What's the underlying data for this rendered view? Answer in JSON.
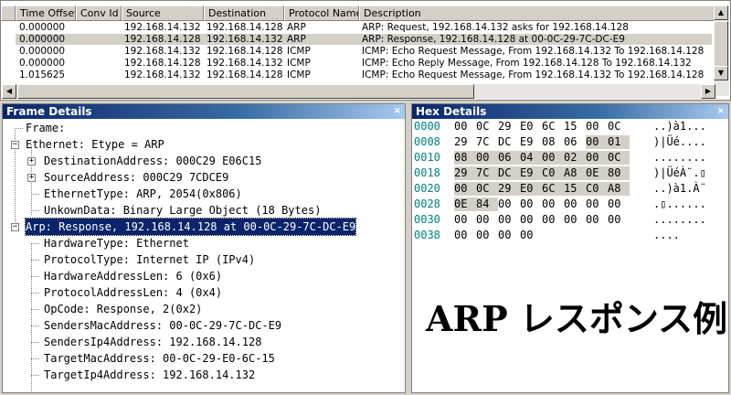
{
  "list": {
    "columns": [
      "Time Offset",
      "Conv Id",
      "Source",
      "Destination",
      "Protocol Name",
      "Description"
    ],
    "rows": [
      {
        "time": "0.000000",
        "conv": "",
        "src": "192.168.14.132",
        "dst": "192.168.14.128",
        "proto": "ARP",
        "desc": "ARP: Request, 192.168.14.132 asks for 192.168.14.128"
      },
      {
        "time": "0.000000",
        "conv": "",
        "src": "192.168.14.128",
        "dst": "192.168.14.132",
        "proto": "ARP",
        "desc": "ARP: Response, 192.168.14.128 at 00-0C-29-7C-DC-E9"
      },
      {
        "time": "0.000000",
        "conv": "",
        "src": "192.168.14.132",
        "dst": "192.168.14.128",
        "proto": "ICMP",
        "desc": "ICMP: Echo Request Message, From 192.168.14.132 To 192.168.14.128"
      },
      {
        "time": "0.000000",
        "conv": "",
        "src": "192.168.14.128",
        "dst": "192.168.14.132",
        "proto": "ICMP",
        "desc": "ICMP: Echo Reply Message, From 192.168.14.128 To 192.168.14.132"
      },
      {
        "time": "1.015625",
        "conv": "",
        "src": "192.168.14.132",
        "dst": "192.168.14.128",
        "proto": "ICMP",
        "desc": "ICMP: Echo Request Message, From 192.168.14.132 To 192.168.14.128"
      }
    ]
  },
  "frame": {
    "title": "Frame Details",
    "close": "×",
    "items": {
      "frame": "Frame:",
      "ethernet": "Ethernet: Etype = ARP",
      "dest": "DestinationAddress: 000C29 E06C15",
      "src": "SourceAddress: 000C29 7CDCE9",
      "etype": "EthernetType: ARP, 2054(0x806)",
      "unk": "UnkownData: Binary Large Object (18 Bytes)",
      "arp": "Arp: Response, 192.168.14.128 at 00-0C-29-7C-DC-E9",
      "hw": "HardwareType: Ethernet",
      "pt": "ProtocolType: Internet IP (IPv4)",
      "hal": "HardwareAddressLen: 6 (0x6)",
      "pal": "ProtocolAddressLen: 4 (0x4)",
      "op": "OpCode: Response, 2(0x2)",
      "smac": "SendersMacAddress: 00-0C-29-7C-DC-E9",
      "sip": "SendersIp4Address: 192.168.14.128",
      "tmac": "TargetMacAddress: 00-0C-29-E0-6C-15",
      "tip": "TargetIp4Address: 192.168.14.132"
    }
  },
  "hex": {
    "title": "Hex Details",
    "close": "×",
    "rows": [
      {
        "off": "0000",
        "bytes": [
          "00",
          "0C",
          "29",
          "E0",
          "6C",
          "15",
          "00",
          "0C"
        ],
        "ascii": "..)à1..."
      },
      {
        "off": "0008",
        "bytes": [
          "29",
          "7C",
          "DC",
          "E9",
          "08",
          "06",
          "00",
          "01"
        ],
        "ascii": ")|Üé...."
      },
      {
        "off": "0010",
        "bytes": [
          "08",
          "00",
          "06",
          "04",
          "00",
          "02",
          "00",
          "0C"
        ],
        "ascii": "........"
      },
      {
        "off": "0018",
        "bytes": [
          "29",
          "7C",
          "DC",
          "E9",
          "C0",
          "A8",
          "0E",
          "80"
        ],
        "ascii": ")|ÜéÀ¨.▯"
      },
      {
        "off": "0020",
        "bytes": [
          "00",
          "0C",
          "29",
          "E0",
          "6C",
          "15",
          "C0",
          "A8"
        ],
        "ascii": "..)à1.À¨"
      },
      {
        "off": "0028",
        "bytes": [
          "0E",
          "84",
          "00",
          "00",
          "00",
          "00",
          "00",
          "00"
        ],
        "ascii": ".▯......"
      },
      {
        "off": "0030",
        "bytes": [
          "00",
          "00",
          "00",
          "00",
          "00",
          "00",
          "00",
          "00"
        ],
        "ascii": "........"
      },
      {
        "off": "0038",
        "bytes": [
          "00",
          "00",
          "00",
          "00"
        ],
        "ascii": "...."
      }
    ]
  },
  "overlay": "ARP レスポンス例"
}
